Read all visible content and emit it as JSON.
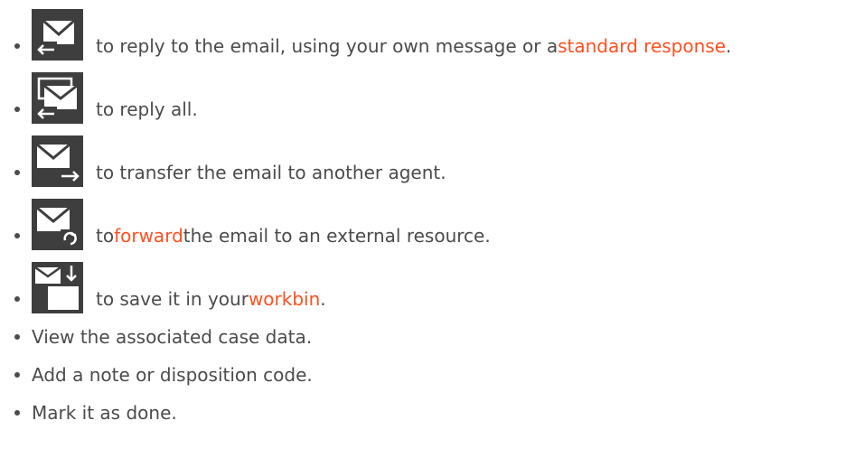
{
  "accent_link_color": "#ff4f1f",
  "icon_background_color": "#3e3e3e",
  "text_color": "#4b4b4b",
  "actions": [
    {
      "icon": "reply-email-icon",
      "text_before": "to reply to the email, using your own message or a ",
      "link": "standard response",
      "text_after": "."
    },
    {
      "icon": "reply-all-email-icon",
      "text_before": "to reply all.",
      "link": "",
      "text_after": ""
    },
    {
      "icon": "transfer-email-icon",
      "text_before": "to transfer the email to another agent.",
      "link": "",
      "text_after": ""
    },
    {
      "icon": "forward-email-icon",
      "text_before": "to ",
      "link": "forward",
      "text_after": " the email to an external resource."
    },
    {
      "icon": "save-to-workbin-icon",
      "text_before": "to save it in your ",
      "link": "workbin",
      "text_after": "."
    }
  ],
  "plain_items": [
    "View the associated case data.",
    "Add a note or disposition code.",
    "Mark it as done."
  ]
}
